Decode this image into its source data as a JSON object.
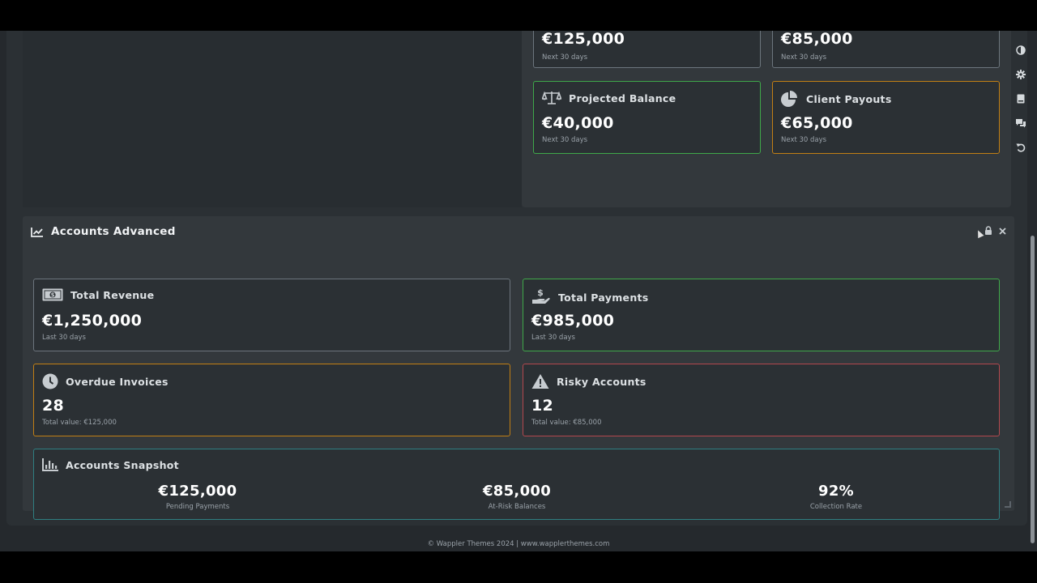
{
  "top_widget": {
    "cards": [
      {
        "title": "",
        "value": "€125,000",
        "sub": "Next 30 days"
      },
      {
        "title": "",
        "value": "€85,000",
        "sub": "Next 30 days"
      },
      {
        "title": "Projected Balance",
        "value": "€40,000",
        "sub": "Next 30 days",
        "icon": "balance-scale-icon",
        "color": "#3fa84a"
      },
      {
        "title": "Client Payouts",
        "value": "€65,000",
        "sub": "Next 30 days",
        "icon": "pie-chart-icon",
        "color": "#c27f14"
      }
    ]
  },
  "sidebar": {
    "items": [
      {
        "icon": "contrast-icon"
      },
      {
        "icon": "gear-icon"
      },
      {
        "icon": "book-icon"
      },
      {
        "icon": "chat-icon"
      },
      {
        "icon": "undo-icon"
      }
    ]
  },
  "advanced_panel": {
    "title": "Accounts Advanced",
    "icon": "line-chart-icon",
    "cards": [
      {
        "title": "Total Revenue",
        "value": "€1,250,000",
        "sub": "Last 30 days",
        "icon": "money-bill-icon",
        "color": "#6c757d"
      },
      {
        "title": "Total Payments",
        "value": "€985,000",
        "sub": "Last 30 days",
        "icon": "hand-holding-dollar-icon",
        "color": "#3fa84a"
      },
      {
        "title": "Overdue Invoices",
        "value": "28",
        "sub": "Total value: €125,000",
        "icon": "clock-icon",
        "color": "#c27f14"
      },
      {
        "title": "Risky Accounts",
        "value": "12",
        "sub": "Total value: €85,000",
        "icon": "warning-icon",
        "color": "#b3484e"
      }
    ],
    "snapshot": {
      "title": "Accounts Snapshot",
      "icon": "bar-chart-icon",
      "color": "#2f7f82",
      "stats": [
        {
          "value": "€125,000",
          "label": "Pending Payments"
        },
        {
          "value": "€85,000",
          "label": "At-Risk Balances"
        },
        {
          "value": "92%",
          "label": "Collection Rate"
        }
      ]
    }
  },
  "footer": {
    "text": "© Wappler Themes 2024 | www.wapplerthemes.com"
  }
}
